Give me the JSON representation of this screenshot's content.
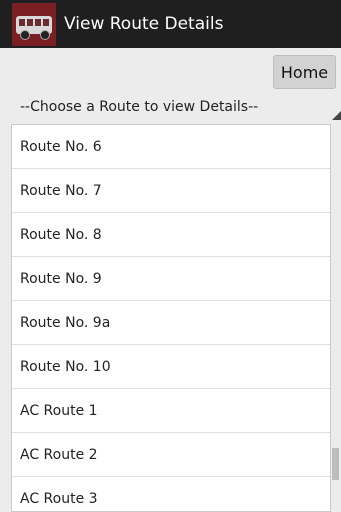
{
  "title_bar": {
    "app_icon": "bus-icon",
    "title": "View Route Details"
  },
  "header": {
    "home_label": "Home"
  },
  "route_spinner": {
    "prompt": "--Choose a Route to view Details--",
    "items": [
      {
        "label": "Route No. 6"
      },
      {
        "label": "Route No. 7"
      },
      {
        "label": "Route No. 8"
      },
      {
        "label": "Route No. 9"
      },
      {
        "label": "Route No. 9a"
      },
      {
        "label": "Route No. 10"
      },
      {
        "label": "AC Route 1"
      },
      {
        "label": "AC Route 2"
      },
      {
        "label": "AC Route 3"
      }
    ]
  },
  "colors": {
    "title_bar_bg": "#1f1f1f",
    "icon_bg": "#7a1f24",
    "page_bg": "#ececec"
  }
}
